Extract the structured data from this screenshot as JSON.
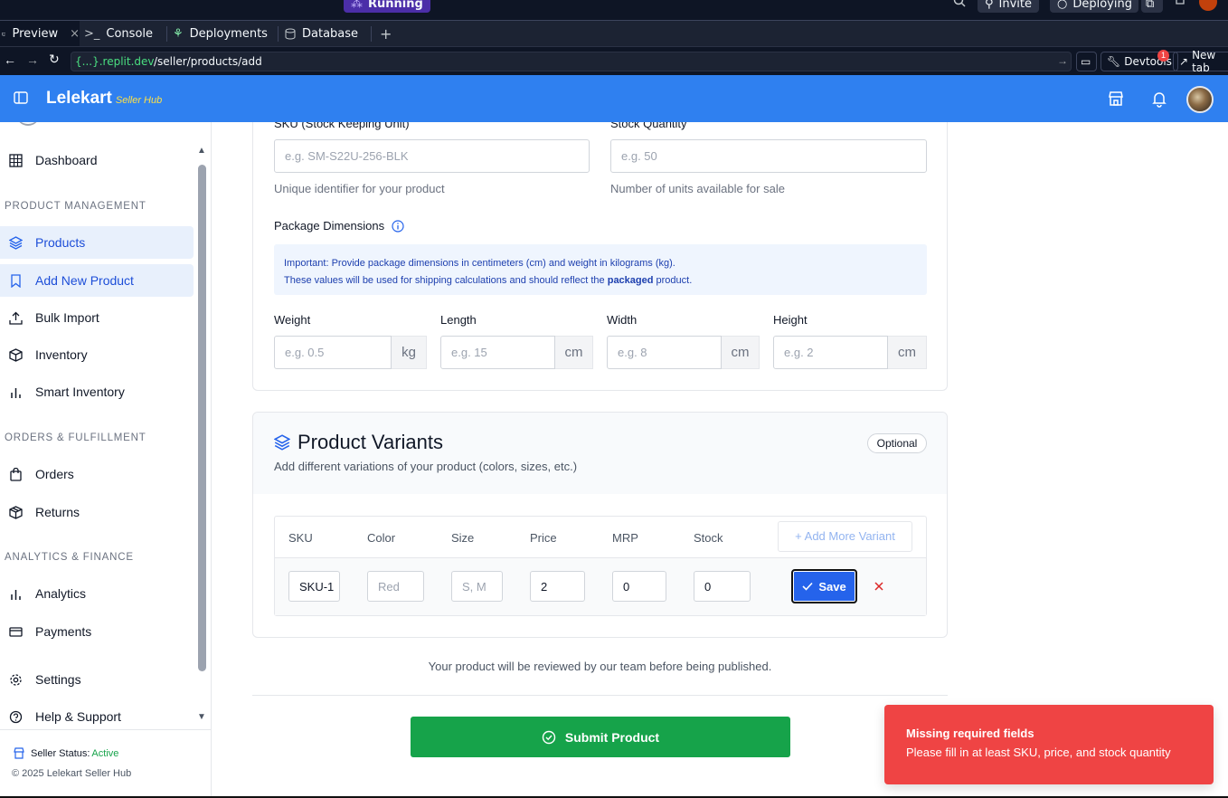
{
  "replit": {
    "status": "Running",
    "invite": "Invite",
    "deploying": "Deploying",
    "notification_count": "1",
    "tabs": [
      {
        "label": "Preview"
      },
      {
        "label": "Console"
      },
      {
        "label": "Deployments"
      },
      {
        "label": "Database"
      }
    ],
    "url_domain": "{...}.replit.dev",
    "url_path": "/seller/products/add",
    "devtools": "Devtools",
    "new_tab": "New tab"
  },
  "app": {
    "brand": "Lelekart",
    "brand_sub": "Seller Hub"
  },
  "sidebar": {
    "dashboard": "Dashboard",
    "section_product": "PRODUCT MANAGEMENT",
    "products": "Products",
    "add_new_product": "Add New Product",
    "bulk_import": "Bulk Import",
    "inventory": "Inventory",
    "smart_inventory": "Smart Inventory",
    "section_orders": "ORDERS & FULFILLMENT",
    "orders": "Orders",
    "returns": "Returns",
    "section_analytics": "ANALYTICS & FINANCE",
    "analytics": "Analytics",
    "payments": "Payments",
    "settings": "Settings",
    "help": "Help & Support",
    "seller_status_label": "Seller Status:",
    "seller_status_value": "Active",
    "copyright": "© 2025 Lelekart Seller Hub"
  },
  "form": {
    "sku_label": "SKU (Stock Keeping Unit)",
    "sku_placeholder": "e.g. SM-S22U-256-BLK",
    "sku_help": "Unique identifier for your product",
    "stock_label": "Stock Quantity",
    "stock_placeholder": "e.g. 50",
    "stock_help": "Number of units available for sale",
    "package_title": "Package Dimensions",
    "info_line1": "Important: Provide package dimensions in centimeters (cm) and weight in kilograms (kg).",
    "info_line2_a": "These values will be used for shipping calculations and should reflect the",
    "info_line2_b": "packaged",
    "info_line2_c": "product.",
    "weight_label": "Weight",
    "weight_placeholder": "e.g. 0.5",
    "weight_unit": "kg",
    "length_label": "Length",
    "length_placeholder": "e.g. 15",
    "length_unit": "cm",
    "width_label": "Width",
    "width_placeholder": "e.g. 8",
    "width_unit": "cm",
    "height_label": "Height",
    "height_placeholder": "e.g. 2",
    "height_unit": "cm"
  },
  "variants": {
    "title": "Product Variants",
    "subtitle": "Add different variations of your product (colors, sizes, etc.)",
    "badge": "Optional",
    "columns": [
      "SKU",
      "Color",
      "Size",
      "Price",
      "MRP",
      "Stock"
    ],
    "add_more": "+ Add More Variant",
    "row": {
      "sku": "SKU-1",
      "color_placeholder": "Red",
      "size_placeholder": "S, M",
      "price": "2",
      "mrp": "0",
      "stock": "0"
    },
    "save": "Save"
  },
  "footer": {
    "review_note": "Your product will be reviewed by our team before being published.",
    "submit": "Submit Product"
  },
  "toast": {
    "title": "Missing required fields",
    "message": "Please fill in at least SKU, price, and stock quantity"
  }
}
